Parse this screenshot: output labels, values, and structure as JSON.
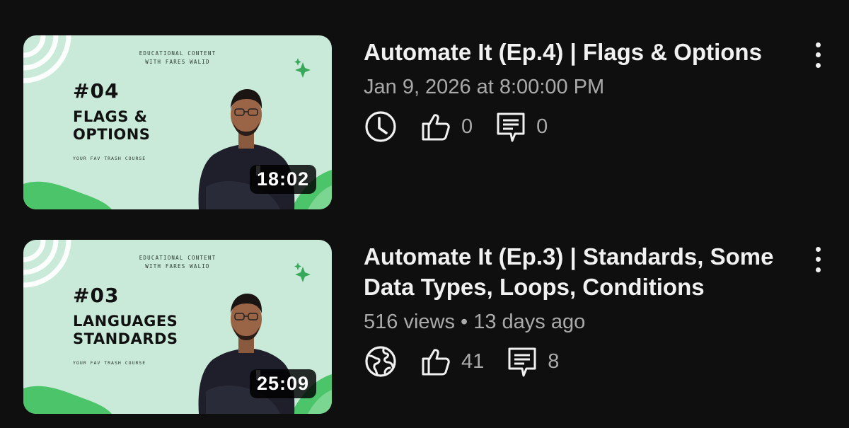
{
  "videos": [
    {
      "thumbnail": {
        "header_line1": "Educational Content",
        "header_line2": "With Fares Walid",
        "episode": "#04",
        "title_line1": "FLAGS &",
        "title_line2": "OPTIONS",
        "course": "Your fav trash course"
      },
      "duration": "18:02",
      "title": "Automate It (Ep.4) | Flags & Options",
      "meta": "Jan 9, 2026 at 8:00:00 PM",
      "status_icon": "clock-icon",
      "likes": "0",
      "comments": "0"
    },
    {
      "thumbnail": {
        "header_line1": "Educational Content",
        "header_line2": "With Fares Walid",
        "episode": "#03",
        "title_line1": "LANGUAGES",
        "title_line2": "STANDARDS",
        "course": "Your fav trash course"
      },
      "duration": "25:09",
      "title": "Automate It (Ep.3) | Standards, Some Data Types, Loops, Conditions",
      "meta": "516 views • 13 days ago",
      "status_icon": "globe-icon",
      "likes": "41",
      "comments": "8"
    }
  ],
  "colors": {
    "background": "#0f0f0f",
    "thumbnail_bg": "#c9ead8",
    "accent_green": "#4cc46a",
    "text_primary": "#f1f1f1",
    "text_secondary": "#aaaaaa"
  }
}
